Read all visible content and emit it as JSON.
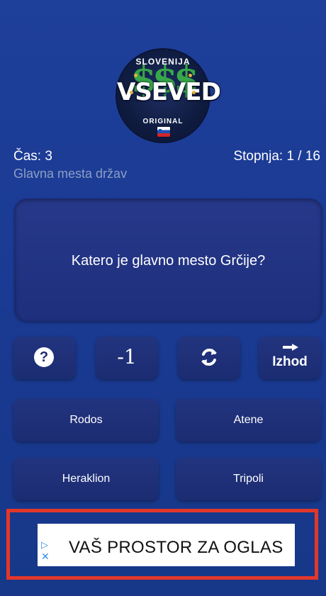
{
  "logo": {
    "top_text": "SLOVENIJA",
    "main_text": "VSEVED",
    "bottom_text": "ORIGINAL",
    "background_glyph": "$$$"
  },
  "status": {
    "time_label": "Čas: 3",
    "level_label": "Stopnja: 1 / 16",
    "category": "Glavna mesta držav"
  },
  "question": {
    "text": "Katero je glavno mesto Grčije?"
  },
  "jokers": {
    "help_symbol": "?",
    "help_icon": "question-circle-icon",
    "minus_label": "-1",
    "swap_icon": "refresh-arrows-icon",
    "exit_icon": "arrow-right-icon",
    "exit_label": "Izhod"
  },
  "answers": [
    {
      "label": "Rodos"
    },
    {
      "label": "Atene"
    },
    {
      "label": "Heraklion"
    },
    {
      "label": "Tripoli"
    }
  ],
  "ad": {
    "text": "VAŠ PROSTOR ZA OGLAS",
    "play_icon": "▷",
    "close_icon": "✕"
  },
  "colors": {
    "background": "#1a3a93",
    "card": "#1e2f7d",
    "text": "#ffffff",
    "category": "#8e9ec4",
    "ad_border": "#e2372a",
    "logo_dollar": "#3cb64a"
  }
}
